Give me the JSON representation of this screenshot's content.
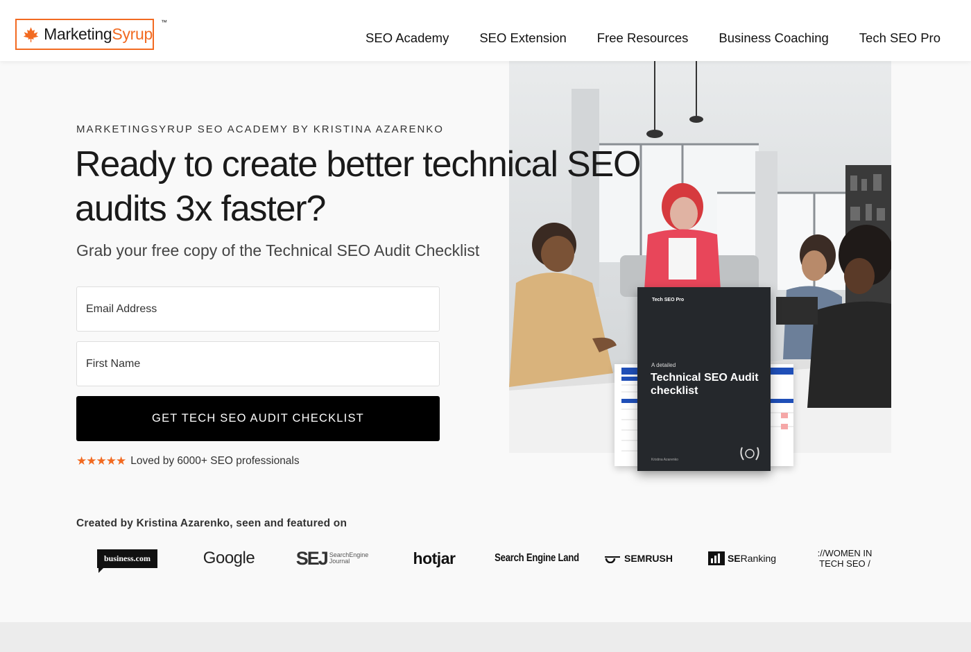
{
  "header": {
    "logo": {
      "text_dark": "Marketing",
      "text_orange": "Syrup",
      "tm": "™"
    },
    "nav": [
      {
        "label": "SEO Academy"
      },
      {
        "label": "SEO Extension"
      },
      {
        "label": "Free Resources"
      },
      {
        "label": "Business Coaching"
      },
      {
        "label": "Tech SEO Pro"
      }
    ]
  },
  "hero": {
    "eyebrow": "MARKETINGSYRUP SEO ACADEMY BY KRISTINA AZARENKO",
    "headline": "Ready to create better technical SEO audits 3x faster?",
    "subhead": "Grab your free copy of the Technical SEO Audit Checklist",
    "form": {
      "email_placeholder": "Email Address",
      "name_placeholder": "First Name",
      "cta_label": "GET TECH SEO AUDIT CHECKLIST"
    },
    "rating": {
      "stars": "★★★★★",
      "text": "Loved by 6000+ SEO professionals"
    }
  },
  "book": {
    "top_label": "Tech SEO Pro",
    "subtitle": "A detailed",
    "title": "Technical SEO Audit checklist",
    "author": "Kristina Azarenko"
  },
  "featured": {
    "label": "Created by Kristina Azarenko, seen and featured on",
    "logos": {
      "business": "business.com",
      "google": "Google",
      "sej_big": "SEJ",
      "sej_line1": "SearchEngine",
      "sej_line2": "Journal",
      "hotjar": "hotjar",
      "sel": "Search Engine Land",
      "semrush": "SEMRUSH",
      "seranking_bold": "SE",
      "seranking_rest": "Ranking",
      "women_line1": "://WOMEN IN",
      "women_line2": "TECH SEO /"
    }
  },
  "colors": {
    "accent": "#f26a21",
    "cta_bg": "#000000",
    "text": "#1a1a1a"
  }
}
